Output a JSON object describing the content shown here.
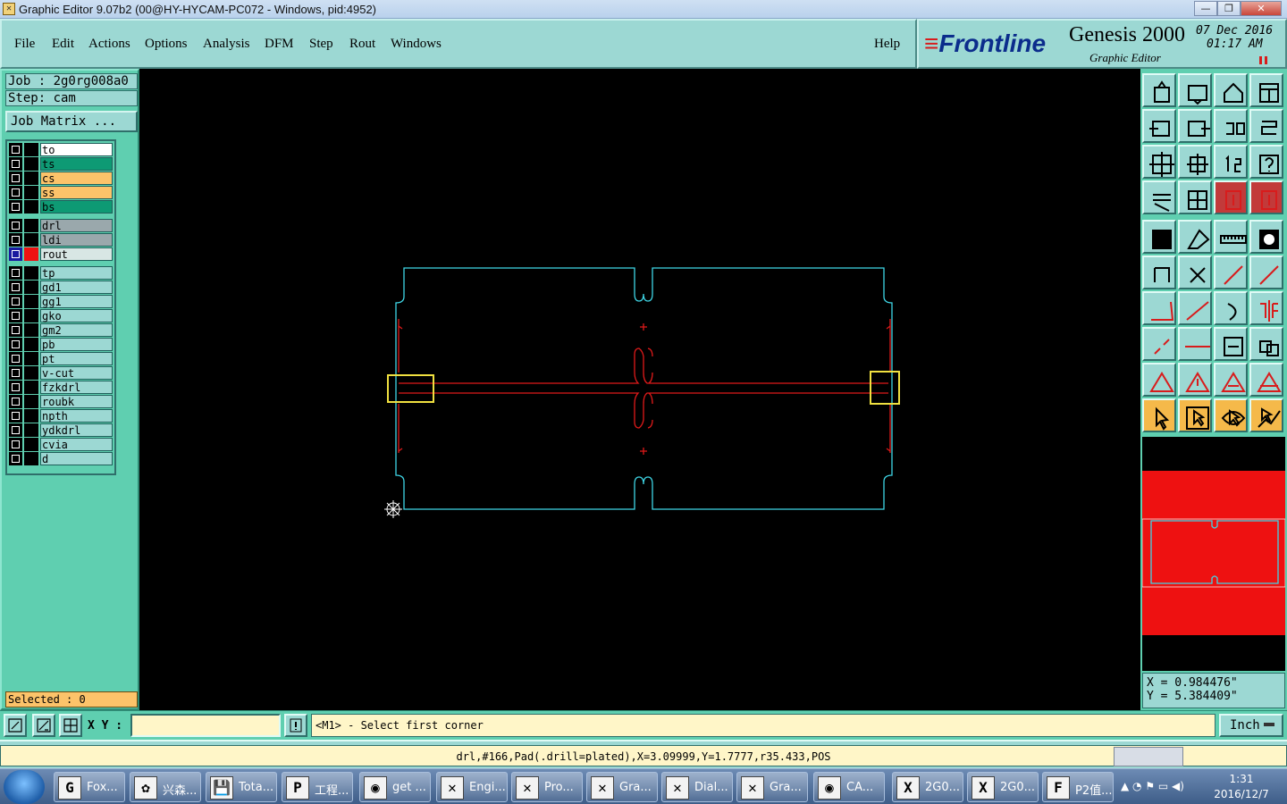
{
  "window": {
    "title": "Graphic Editor 9.07b2 (00@HY-HYCAM-PC072 - Windows, pid:4952)",
    "controls": [
      "—",
      "❐",
      "✕"
    ]
  },
  "menu": {
    "items": [
      "File",
      "Edit",
      "Actions",
      "Options",
      "Analysis",
      "DFM",
      "Step",
      "Rout",
      "Windows"
    ],
    "help": "Help"
  },
  "brand": {
    "logo": "Frontline",
    "product": "Genesis 2000",
    "subtitle": "Graphic Editor",
    "date": "07 Dec 2016",
    "time": "01:17 AM"
  },
  "job": {
    "job_label": "Job : 2g0rg008a0",
    "step_label": "Step: cam",
    "matrix_button": "Job Matrix ...",
    "selected": "Selected : 0"
  },
  "layers": [
    {
      "name": "to",
      "color": "#ffffff",
      "mark": ""
    },
    {
      "name": "ts",
      "color": "#0e9a74",
      "mark": ""
    },
    {
      "name": "cs",
      "color": "#fcc36a",
      "mark": ""
    },
    {
      "name": "ss",
      "color": "#fcc36a",
      "mark": ""
    },
    {
      "name": "bs",
      "color": "#0e9a74",
      "mark": ""
    },
    {
      "name": "drl",
      "color": "#9aa8ac",
      "mark": ""
    },
    {
      "name": "ldi",
      "color": "#9aa8ac",
      "mark": ""
    },
    {
      "name": "rout",
      "color": "#d8e6e4",
      "mark": "▣"
    },
    {
      "name": "tp",
      "color": "#9cd8d3",
      "mark": ""
    },
    {
      "name": "gd1",
      "color": "#9cd8d3",
      "mark": "✎"
    },
    {
      "name": "gg1",
      "color": "#9cd8d3",
      "mark": ""
    },
    {
      "name": "gko",
      "color": "#9cd8d3",
      "mark": "✎"
    },
    {
      "name": "gm2",
      "color": "#9cd8d3",
      "mark": ""
    },
    {
      "name": "pb",
      "color": "#9cd8d3",
      "mark": ""
    },
    {
      "name": "pt",
      "color": "#9cd8d3",
      "mark": ""
    },
    {
      "name": "v-cut",
      "color": "#9cd8d3",
      "mark": ""
    },
    {
      "name": "fzkdrl",
      "color": "#9cd8d3",
      "mark": ""
    },
    {
      "name": "roubk",
      "color": "#9cd8d3",
      "mark": ""
    },
    {
      "name": "npth",
      "color": "#9cd8d3",
      "mark": ""
    },
    {
      "name": "ydkdrl",
      "color": "#9cd8d3",
      "mark": ""
    },
    {
      "name": "cvia",
      "color": "#9cd8d3",
      "mark": ""
    },
    {
      "name": "d",
      "color": "#9cd8d3",
      "mark": ""
    }
  ],
  "coords": {
    "x": "X = 0.984476\"",
    "y": "Y = 5.384409\""
  },
  "command": {
    "xy_label": "X Y :",
    "xy_value": "",
    "prompt": "<M1> - Select first corner",
    "unit": "Inch"
  },
  "status": "drl,#166,Pad(.drill=plated),X=3.09999,Y=1.7777,r35.433,POS",
  "taskbar": {
    "items": [
      "Fox...",
      "兴森...",
      "Tota...",
      "工程...",
      "get ...",
      "Engi...",
      "Pro...",
      "Gra...",
      "Dial...",
      "Gra...",
      "CA...",
      "2G0...",
      "2G0...",
      "P2值..."
    ],
    "clock_time": "1:31",
    "clock_date": "2016/12/7"
  },
  "colors": {
    "profile": "#3fd6e6",
    "rout": "#e01a1a",
    "highlight": "#f0e040",
    "panel": "#5fcfb0",
    "button": "#9cd8d3"
  }
}
